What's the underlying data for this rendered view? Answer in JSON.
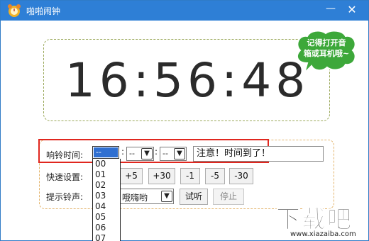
{
  "window": {
    "title": "啪啪闹钟",
    "minimize_glyph": "—",
    "close_glyph": "✕"
  },
  "clock": {
    "time": "16:56:48"
  },
  "bubble": {
    "line1": "记得打开音",
    "line2": "箱或耳机哦~",
    "color": "#3da83a"
  },
  "alarm": {
    "label": "响铃时间:",
    "hour_value": "--",
    "minute_value": "--",
    "second_value": "--",
    "separator": ":",
    "message": "注意！时间到了！",
    "hour_options": [
      "00",
      "01",
      "02",
      "03",
      "04",
      "05",
      "06",
      "07"
    ]
  },
  "quick": {
    "label": "快速设置:",
    "buttons": [
      "+5",
      "+30",
      "-1",
      "-5",
      "-30"
    ]
  },
  "tone": {
    "label": "提示铃声:",
    "value": "哦嗨哟",
    "listen_label": "试听",
    "stop_label": "停止"
  },
  "watermark": {
    "logo_text": "下载吧",
    "url": "www.xiazaiba.com"
  },
  "colors": {
    "titlebar": "#2e7fd6",
    "highlight": "#e0271f",
    "selection": "#2f6fd1"
  }
}
